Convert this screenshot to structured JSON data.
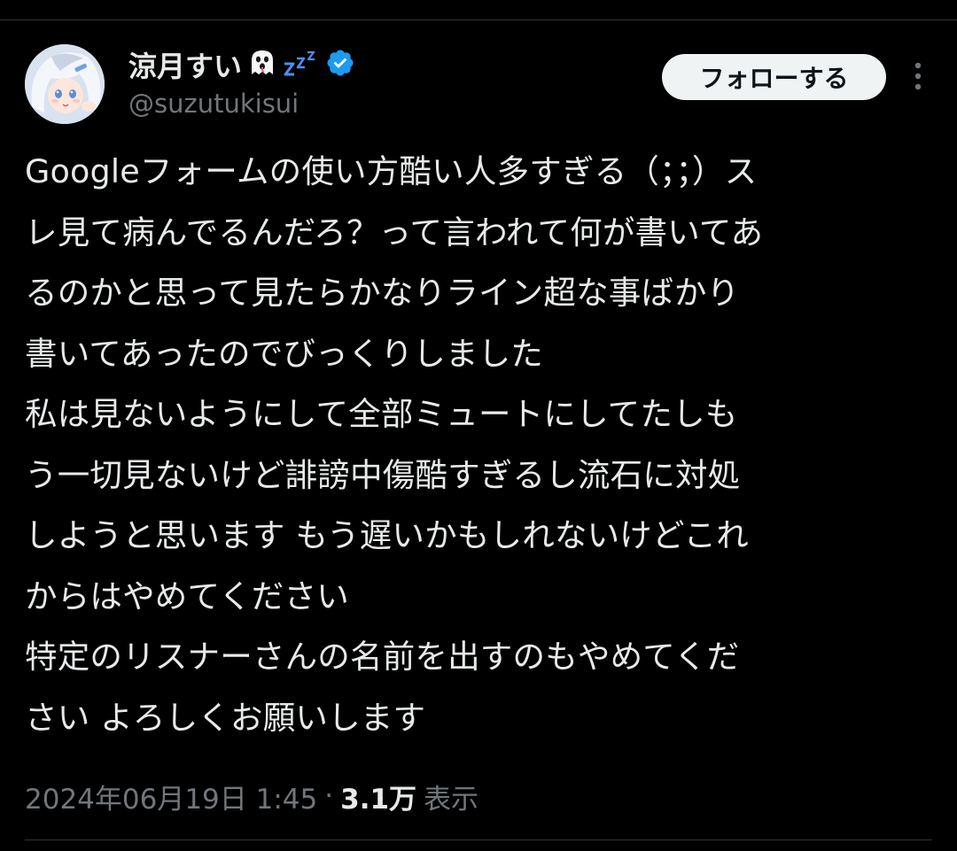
{
  "author": {
    "display_name": "涼月すい",
    "handle": "@suzutukisui",
    "verified": true,
    "verified_color": "#1d9bf0",
    "name_emojis": [
      "ghost-icon",
      "zzz-icon"
    ]
  },
  "actions": {
    "follow_label": "フォローする",
    "more_icon": "more-horizontal-icon"
  },
  "tweet": {
    "lines": [
      "Googleフォームの使い方酷い人多すぎる（；；）ス",
      "レ見て病んでるんだろ？って言われて何が書いてあ",
      "るのかと思って見たらかなりライン超な事ばかり",
      "書いてあったのでびっくりしました",
      "私は見ないようにして全部ミュートにしてたしも",
      "う一切見ないけど誹謗中傷酷すぎるし流石に対処",
      "しようと思います もう遅いかもしれないけどこれ",
      "からはやめてください",
      "特定のリスナーさんの名前を出すのもやめてくだ",
      "さい よろしくお願いします"
    ]
  },
  "meta": {
    "timestamp": "2024年06月19日 1:45",
    "separator": "·",
    "views_count": "3.1万",
    "views_label": "表示"
  },
  "colors": {
    "background": "#000000",
    "text_primary": "#e7e9ea",
    "text_secondary": "#71767b",
    "divider": "#2f3336",
    "follow_bg": "#eff3f4",
    "follow_text": "#0f1419"
  }
}
